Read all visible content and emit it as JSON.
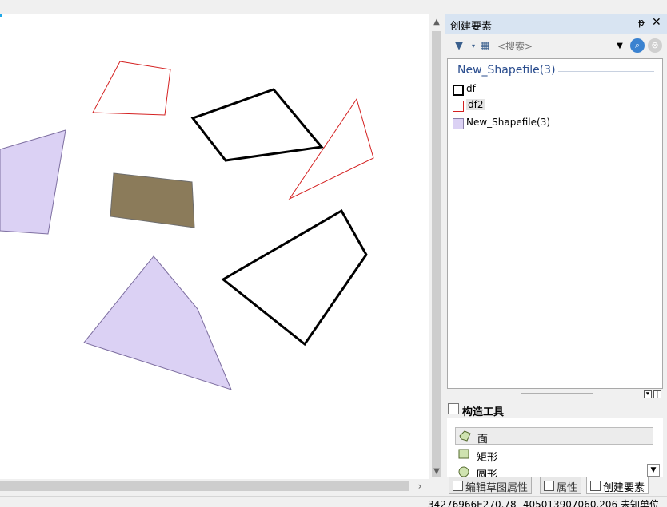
{
  "colors": {
    "purple_fill": "#dbd1f4",
    "brown_fill": "#8b7b5a",
    "red_outline": "#d42020",
    "black_outline": "#000000",
    "panel_title_bg": "#d8e4f2",
    "group_header": "#2a4d8e"
  },
  "panel": {
    "title": "创建要素",
    "pin_icon": "pin-icon",
    "close_icon": "close-icon",
    "search_placeholder": "<搜索>",
    "group_header": "New_Shapefile(3)",
    "templates": [
      {
        "label": "df",
        "style": "black-outline"
      },
      {
        "label": "df2",
        "style": "red-outline"
      },
      {
        "label": "New_Shapefile(3)",
        "style": "purple-fill"
      }
    ],
    "tools_title": "构造工具",
    "tools": [
      {
        "label": "面",
        "icon": "polygon-tool-icon"
      },
      {
        "label": "矩形",
        "icon": "rectangle-tool-icon"
      },
      {
        "label": "圆形",
        "icon": "circle-tool-icon"
      }
    ]
  },
  "tabs": [
    {
      "label": "编辑草图属性"
    },
    {
      "label": "属性"
    },
    {
      "label": "创建要素"
    }
  ],
  "status": {
    "coords": "34276966E270.78  -405013907060.206 未知单位"
  }
}
